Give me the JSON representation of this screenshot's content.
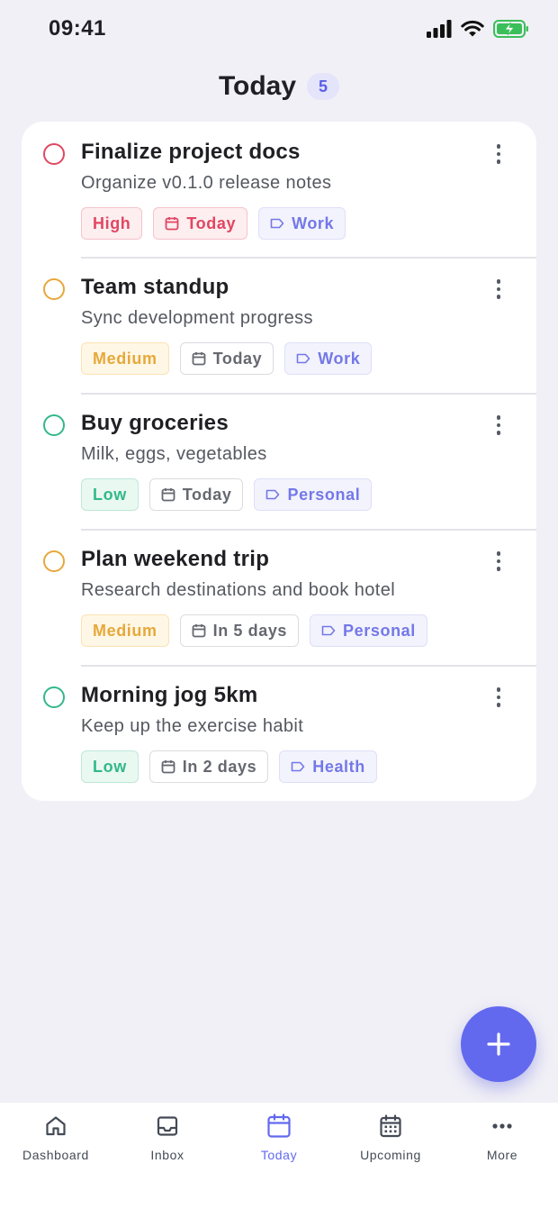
{
  "status_bar": {
    "time": "09:41"
  },
  "header": {
    "title": "Today",
    "count": "5"
  },
  "colors": {
    "accent": "#6269ef",
    "high": "#e04762",
    "medium": "#e7a83a",
    "low": "#32b88b"
  },
  "tasks": [
    {
      "title": "Finalize project docs",
      "description": "Organize v0.1.0 release notes",
      "priority": "High",
      "date": "Today",
      "label": "Work"
    },
    {
      "title": "Team standup",
      "description": "Sync development progress",
      "priority": "Medium",
      "date": "Today",
      "label": "Work"
    },
    {
      "title": "Buy groceries",
      "description": "Milk, eggs, vegetables",
      "priority": "Low",
      "date": "Today",
      "label": "Personal"
    },
    {
      "title": "Plan weekend trip",
      "description": "Research destinations and book hotel",
      "priority": "Medium",
      "date": "In 5 days",
      "label": "Personal"
    },
    {
      "title": "Morning jog 5km",
      "description": "Keep up the exercise habit",
      "priority": "Low",
      "date": "In 2 days",
      "label": "Health"
    }
  ],
  "fab": {
    "icon": "plus-icon"
  },
  "nav": {
    "items": [
      {
        "label": "Dashboard",
        "icon": "home-icon"
      },
      {
        "label": "Inbox",
        "icon": "inbox-icon"
      },
      {
        "label": "Today",
        "icon": "calendar-icon"
      },
      {
        "label": "Upcoming",
        "icon": "calendar-grid-icon"
      },
      {
        "label": "More",
        "icon": "more-horizontal-icon"
      }
    ],
    "active": "Today"
  }
}
